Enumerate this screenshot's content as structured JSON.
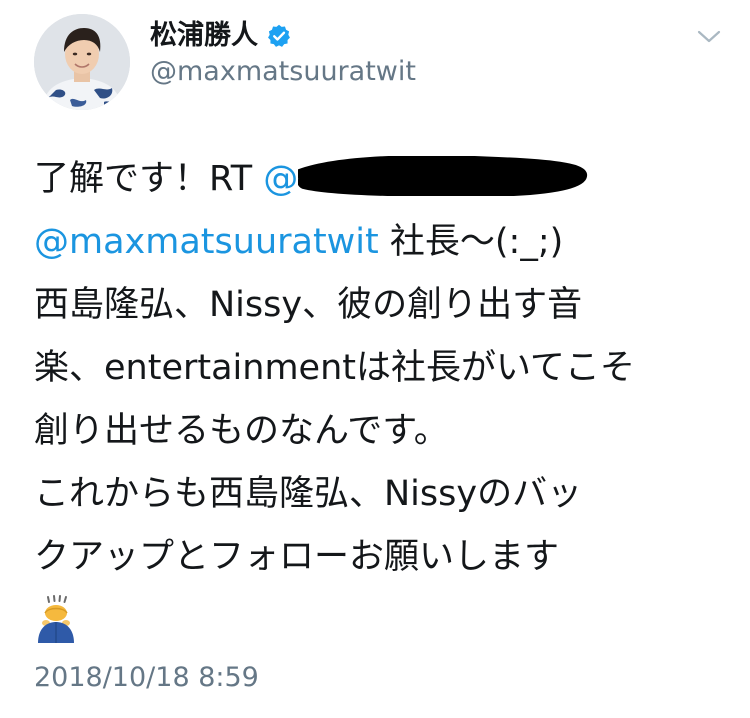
{
  "author": {
    "display_name": "松浦勝人",
    "handle": "@maxmatsuuratwit",
    "verified_icon": "verified-badge-icon",
    "avatar_icon": "profile-photo"
  },
  "menu": {
    "icon": "chevron-down-icon"
  },
  "tweet": {
    "line1_text": "了解です！RT",
    "line1_mention_fragment": "@",
    "line2_mention": "@maxmatsuuratwit",
    "line2_text": " 社長〜(:_;)",
    "line3": "西島隆弘、Nissy、彼の創り出す音",
    "line4": "楽、entertainmentは社長がいてこそ",
    "line5": "創り出せるものなんです。",
    "line6": "これからも西島隆弘、Nissyのバッ",
    "line7": "クアップとフォローお願いします",
    "emoji_icon": "person-bowing-emoji-icon",
    "timestamp": "2018/10/18 8:59"
  },
  "colors": {
    "text": "#14171a",
    "secondary": "#657786",
    "link": "#1b95e0",
    "verified": "#1da1f2",
    "background": "#ffffff"
  }
}
